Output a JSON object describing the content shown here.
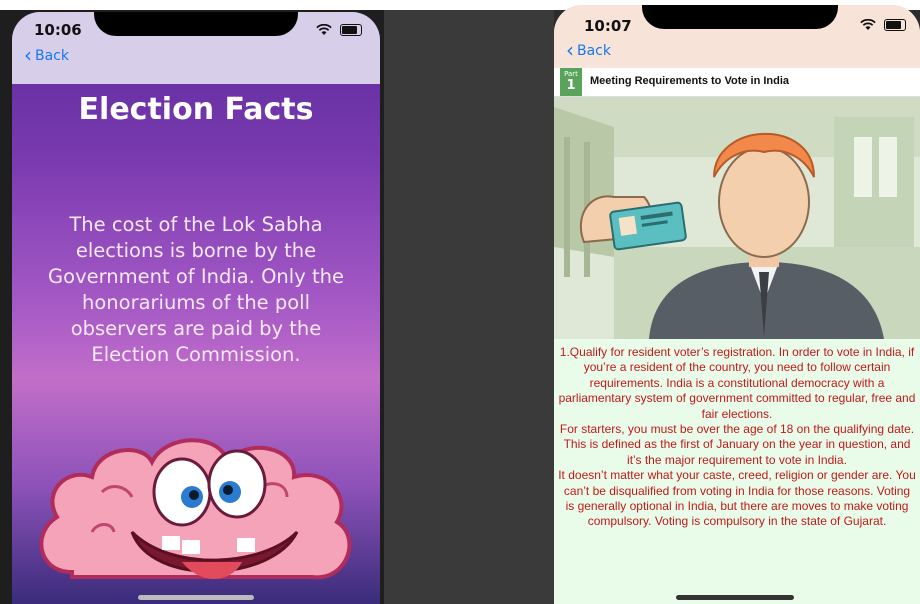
{
  "left_screen": {
    "status": {
      "time": "10:06"
    },
    "nav": {
      "back_label": "Back"
    },
    "title": "Election Facts",
    "body": "The cost of the Lok Sabha elections is borne by the Government of India. Only the honorariums of the poll observers are paid by the Election Commission.",
    "gradient": [
      "#5a2a9a",
      "#c26ec9",
      "#3a2c7a"
    ]
  },
  "right_screen": {
    "status": {
      "time": "10:07"
    },
    "nav": {
      "back_label": "Back"
    },
    "part": {
      "label": "Part",
      "number": "1",
      "title": "Meeting Requirements to Vote in India"
    },
    "article": {
      "paragraphs": [
        "1.Qualify for resident voter’s registration. In order to vote in India, if you’re a resident of the country, you need to follow certain requirements. India is a constitutional democracy with a parliamentary system of government committed to regular, free and fair elections.",
        "For starters, you must be over the age of 18 on the qualifying date. This is defined as the first of January on the year in question, and it’s the major requirement to vote in India.",
        "It doesn’t matter what your caste, creed, religion or gender are. You can’t be disqualified from voting in India for those reasons. Voting is generally optional in India, but there are moves to make voting compulsory. Voting is compulsory in the state of Gujarat."
      ],
      "text_color": "#c11a1a",
      "background": "#e9fbe9"
    }
  },
  "colors": {
    "accent": "#1877f2",
    "part_badge": "#5aa35a"
  }
}
